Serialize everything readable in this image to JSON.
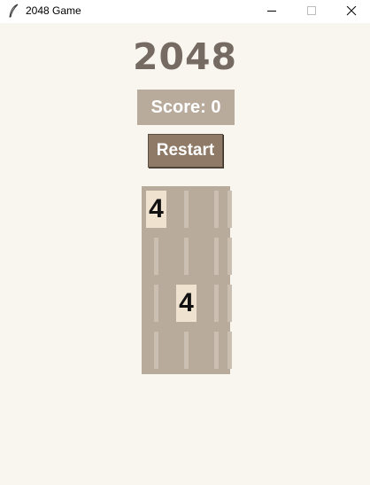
{
  "window": {
    "title": "2048 Game",
    "icon": "feather-icon",
    "controls": [
      "minimize-icon",
      "maximize-icon",
      "close-icon"
    ]
  },
  "game": {
    "title": "2048",
    "score_label": "Score: 0",
    "restart_label": "Restart"
  },
  "board": {
    "rows": 4,
    "cols": 4,
    "cells": [
      [
        4,
        0,
        0,
        0
      ],
      [
        0,
        0,
        0,
        0
      ],
      [
        0,
        4,
        0,
        0
      ],
      [
        0,
        0,
        0,
        0
      ]
    ]
  },
  "colors": {
    "background": "#f9f6ef",
    "board": "#b9ab9c",
    "empty_cell": "#cbbfb1",
    "tile_4": "#efe3cf",
    "title_text": "#766b63",
    "restart_button": "#8f7a67"
  }
}
